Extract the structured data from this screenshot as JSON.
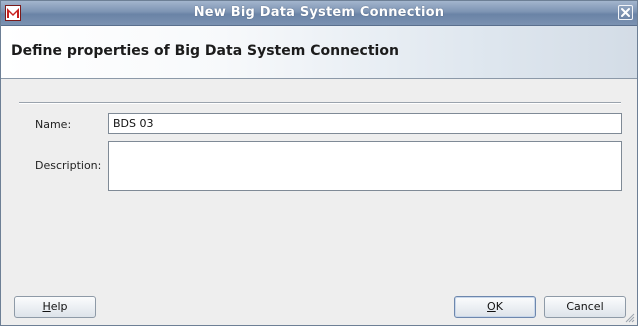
{
  "window": {
    "title": "New Big Data System Connection",
    "icon": "app-icon",
    "close_icon": "close-icon"
  },
  "banner": {
    "title": "Define properties of Big Data System Connection"
  },
  "form": {
    "name_label": "Name:",
    "name_value": "BDS 03",
    "description_label": "Description:",
    "description_value": ""
  },
  "buttons": {
    "help": {
      "mnemonic": "H",
      "rest": "elp"
    },
    "ok": {
      "mnemonic": "O",
      "rest": "K"
    },
    "cancel": "Cancel"
  },
  "colors": {
    "titlebar": "#7d94b3",
    "dialog_bg": "#eeeeee",
    "app_icon_red": "#c8211f"
  }
}
